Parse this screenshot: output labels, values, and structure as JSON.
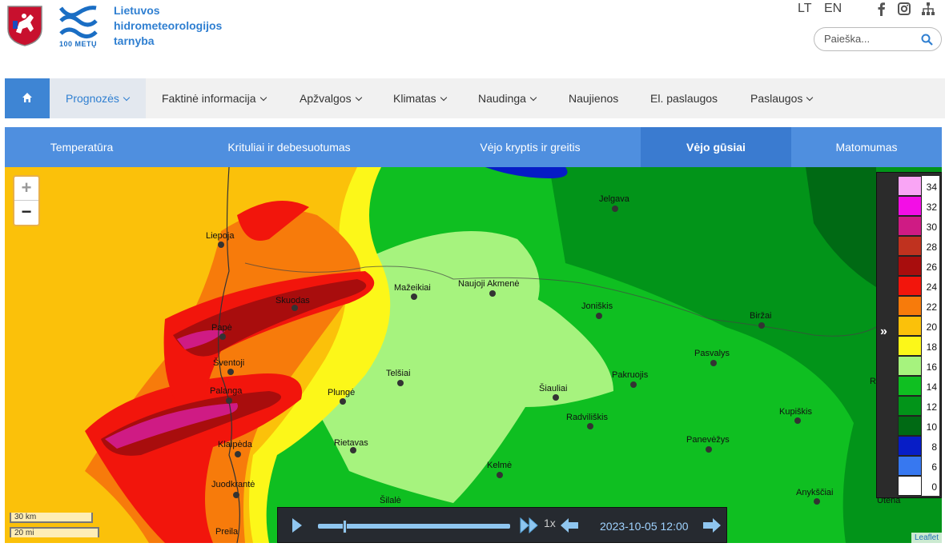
{
  "header": {
    "org_line1": "Lietuvos",
    "org_line2": "hidrometeorologijos",
    "org_line3": "tarnyba",
    "logo_years": "100 METŲ",
    "lang_lt": "LT",
    "lang_en": "EN",
    "social_icons": [
      "facebook-icon",
      "instagram-icon",
      "sitemap-icon"
    ],
    "search_placeholder": "Paieška..."
  },
  "mainnav": {
    "home_icon": "home-icon",
    "items": [
      {
        "label": "Prognozės",
        "dropdown": true,
        "active": true
      },
      {
        "label": "Faktinė informacija",
        "dropdown": true
      },
      {
        "label": "Apžvalgos",
        "dropdown": true
      },
      {
        "label": "Klimatas",
        "dropdown": true
      },
      {
        "label": "Naudinga",
        "dropdown": true
      },
      {
        "label": "Naujienos",
        "dropdown": false
      },
      {
        "label": "El. paslaugos",
        "dropdown": false
      },
      {
        "label": "Paslaugos",
        "dropdown": true
      }
    ]
  },
  "subnav": {
    "tabs": [
      {
        "label": "Temperatūra"
      },
      {
        "label": "Krituliai ir debesuotumas"
      },
      {
        "label": "Vėjo kryptis ir greitis"
      },
      {
        "label": "Vėjo gūsiai",
        "active": true
      },
      {
        "label": "Matomumas"
      }
    ]
  },
  "map": {
    "zoom_in": "+",
    "zoom_out": "−",
    "cities": [
      "Jelgava",
      "Liepoja",
      "Mažeikiai",
      "Naujoji Akmenė",
      "Skuodas",
      "Joniškis",
      "Biržai",
      "Papė",
      "Pasvalys",
      "Šventoji",
      "Telšiai",
      "Pakruojis",
      "Šiauliai",
      "Palanga",
      "Plungė",
      "Radviliškis",
      "Kupiškis",
      "Klaipėda",
      "Rietavas",
      "Panevėžys",
      "Kelmė",
      "Juodkrantė",
      "Anykščiai",
      "Šilalė",
      "Utena",
      "Preila",
      "R"
    ],
    "scale_km": "30 km",
    "scale_mi": "20 mi",
    "attribution": "Leaflet"
  },
  "legend": {
    "toggle_icon": "double-chevron-right-icon",
    "items": [
      {
        "label": "34",
        "color": "#f9a5f5"
      },
      {
        "label": "32",
        "color": "#f30ee6"
      },
      {
        "label": "30",
        "color": "#cf1b84"
      },
      {
        "label": "28",
        "color": "#c0321f"
      },
      {
        "label": "26",
        "color": "#a80d0d"
      },
      {
        "label": "24",
        "color": "#f2150c"
      },
      {
        "label": "22",
        "color": "#f77b0b"
      },
      {
        "label": "20",
        "color": "#fbc10a"
      },
      {
        "label": "18",
        "color": "#fcf719"
      },
      {
        "label": "16",
        "color": "#a6f37e"
      },
      {
        "label": "14",
        "color": "#0fbf21"
      },
      {
        "label": "12",
        "color": "#029419"
      },
      {
        "label": "10",
        "color": "#006a14"
      },
      {
        "label": "8",
        "color": "#071dc6"
      },
      {
        "label": "6",
        "color": "#3778f0"
      },
      {
        "label": "0",
        "color": "#ffffff"
      }
    ]
  },
  "player": {
    "play_icon": "play-icon",
    "forward_icon": "fast-forward-icon",
    "speed": "1x",
    "back_icon": "arrow-left-icon",
    "time": "2023-10-05 12:00",
    "next_icon": "arrow-right-icon",
    "progress": 0.13
  }
}
